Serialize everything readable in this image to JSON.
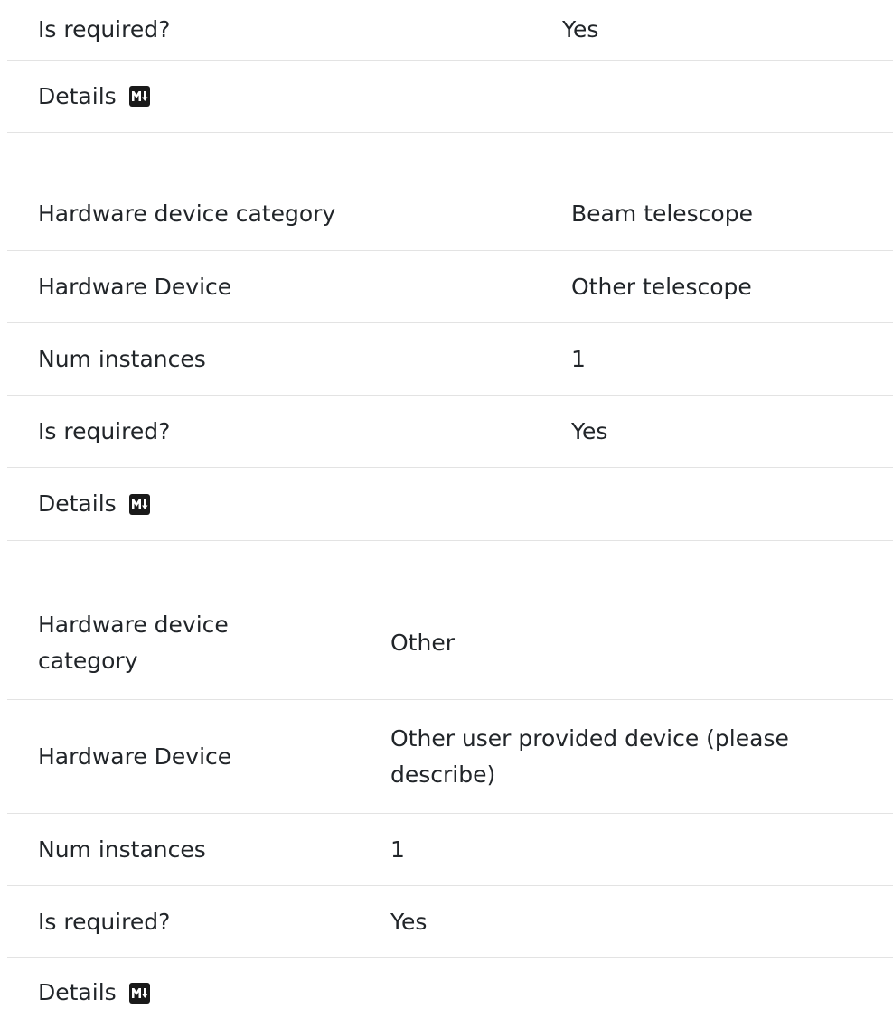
{
  "section1": {
    "is_required_label": "Is required?",
    "is_required_value": "Yes",
    "details_label": "Details"
  },
  "section2": {
    "category_label": "Hardware device category",
    "category_value": "Beam telescope",
    "device_label": "Hardware Device",
    "device_value": "Other telescope",
    "instances_label": "Num instances",
    "instances_value": "1",
    "is_required_label": "Is required?",
    "is_required_value": "Yes",
    "details_label": "Details"
  },
  "section3": {
    "category_label": "Hardware device category",
    "category_value": "Other",
    "device_label": "Hardware Device",
    "device_value": "Other user provided device (please describe)",
    "instances_label": "Num instances",
    "instances_value": "1",
    "is_required_label": "Is required?",
    "is_required_value": "Yes",
    "details_label": "Details"
  },
  "icons": {
    "markdown": "markdown-icon"
  }
}
